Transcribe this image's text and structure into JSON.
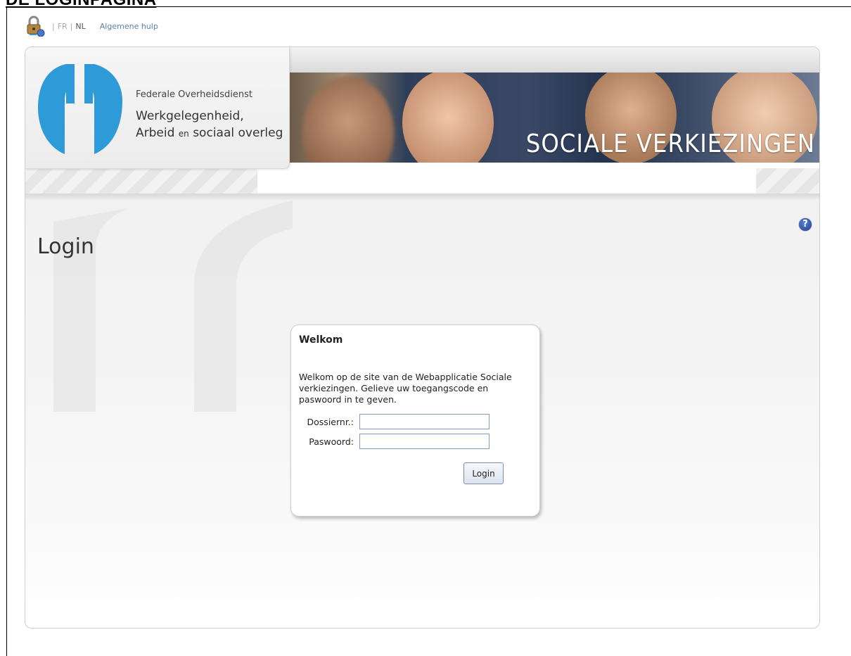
{
  "document": {
    "heading": "DE LOGINPAGINA"
  },
  "topbar": {
    "lang_fr": "FR",
    "lang_nl": "NL",
    "separator": "|",
    "help_link": "Algemene hulp"
  },
  "header": {
    "org_line1": "Federale Overheidsdienst",
    "org_line2": "Werkgelegenheid,",
    "org_line3_a": "Arbeid ",
    "org_line3_b": "en",
    "org_line3_c": " sociaal overleg",
    "banner_title": "SOCIALE VERKIEZINGEN"
  },
  "page": {
    "title": "Login",
    "help_icon": "?"
  },
  "login": {
    "title": "Welkom",
    "intro": "Welkom op de site van de Webapplicatie Sociale verkiezingen. Gelieve uw toegangscode en paswoord in te geven.",
    "dossier_label": "Dossiernr.:",
    "dossier_value": "",
    "password_label": "Paswoord:",
    "password_value": "",
    "button_label": "Login"
  },
  "colors": {
    "logo_blue": "#2e9ad8",
    "link_blue": "#5a7fa8",
    "help_icon_blue": "#1c3f96"
  },
  "icons": {
    "lock": "lock-icon",
    "help": "help-icon"
  }
}
